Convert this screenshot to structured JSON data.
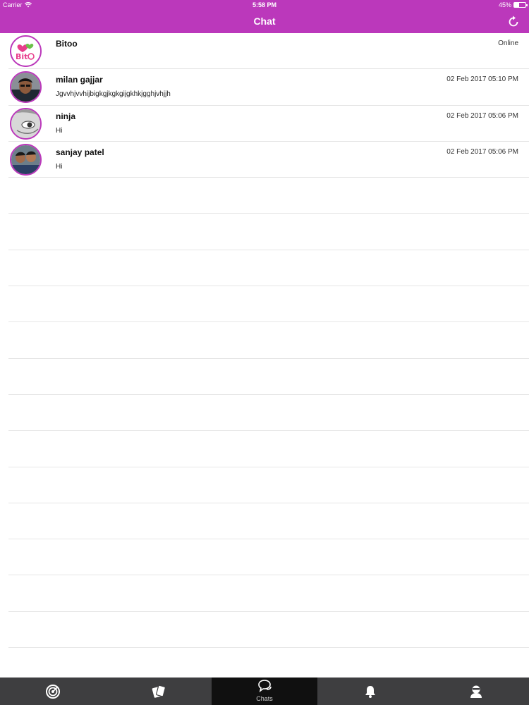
{
  "status_bar": {
    "carrier": "Carrier",
    "time": "5:58 PM",
    "battery": "45%",
    "battery_level": 0.45
  },
  "nav": {
    "title": "Chat"
  },
  "conversations": [
    {
      "name": "Bitoo",
      "message": "",
      "meta": "Online",
      "avatar": "bitoo-logo"
    },
    {
      "name": "milan gajjar",
      "message": "Jgvvhjvvhijbigkgjkgkgijgkhkjgghjvhjjh",
      "meta": "02 Feb 2017 05:10 PM",
      "avatar": "photo"
    },
    {
      "name": "ninja",
      "message": "Hi",
      "meta": "02 Feb 2017 05:06 PM",
      "avatar": "photo"
    },
    {
      "name": "sanjay patel",
      "message": "Hi",
      "meta": "02 Feb 2017 05:06 PM",
      "avatar": "photo"
    }
  ],
  "tabs": [
    {
      "icon": "target-icon",
      "label": ""
    },
    {
      "icon": "cards-icon",
      "label": ""
    },
    {
      "icon": "chat-bubbles-icon",
      "label": "Chats"
    },
    {
      "icon": "bell-icon",
      "label": ""
    },
    {
      "icon": "profile-icon",
      "label": ""
    }
  ],
  "colors": {
    "accent": "#bb38bb",
    "tabbar": "#3e3e40",
    "tab_active": "#101010"
  }
}
